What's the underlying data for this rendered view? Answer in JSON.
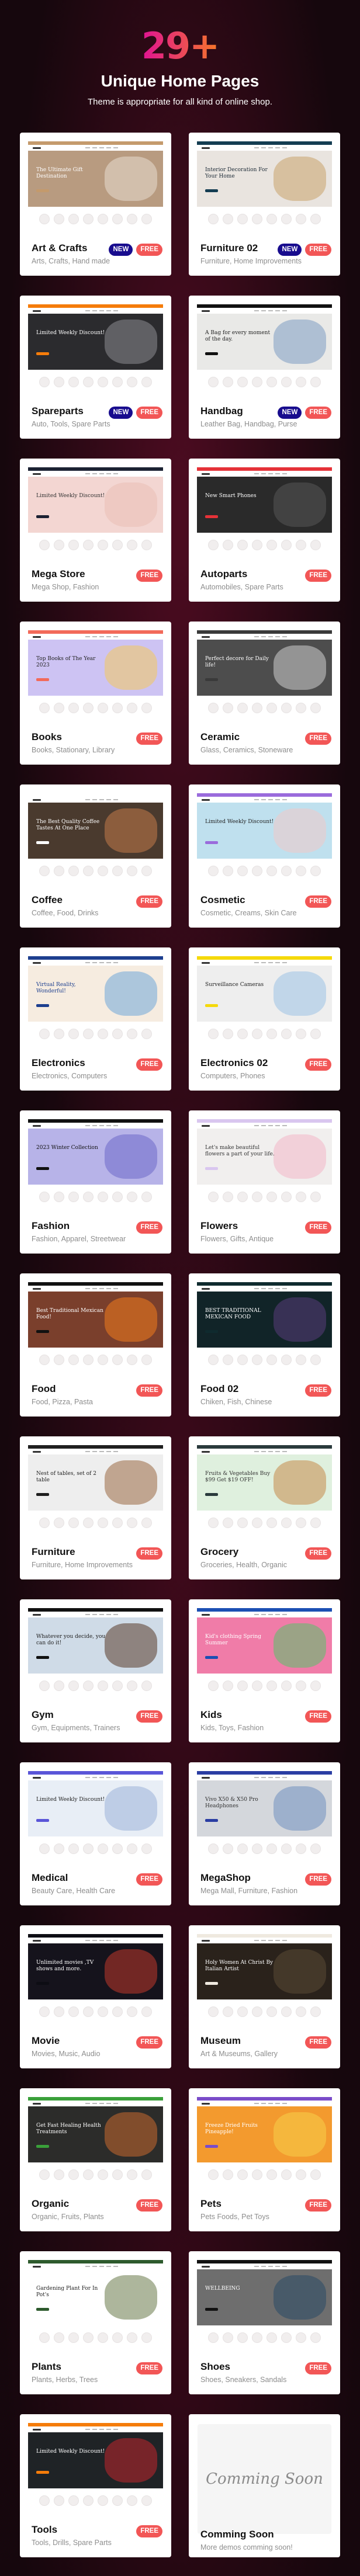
{
  "header": {
    "count": "29+",
    "title": "Unique Home Pages",
    "subtitle": "Theme is appropriate for all kind of online shop."
  },
  "colors": {
    "new_badge": "#180c8e",
    "free_badge": "#f25656",
    "count_gradient": [
      "#e0168f",
      "#f5732c"
    ]
  },
  "cards": [
    {
      "title": "Art & Crafts",
      "subtitle": "Arts, Crafts, Hand made",
      "badges": [
        "NEW",
        "FREE"
      ],
      "preview": {
        "bar": "#c49a6c",
        "hero": "#b89b80",
        "deco": "#e8dccf",
        "text": "The Ultimate Gift Destination",
        "text_color": "#fff"
      }
    },
    {
      "title": "Furniture 02",
      "subtitle": "Furniture, Home Improvements",
      "badges": [
        "NEW",
        "FREE"
      ],
      "preview": {
        "bar": "#143d52",
        "hero": "#e9e4df",
        "deco": "#c9a26a",
        "text": "Interior Decoration For Your Home",
        "text_color": "#1c2a36"
      }
    },
    {
      "title": "Spareparts",
      "subtitle": "Auto, Tools, Spare Parts",
      "badges": [
        "NEW",
        "FREE"
      ],
      "preview": {
        "bar": "#f57c0a",
        "hero": "#2b2b2e",
        "deco": "#8d8d92",
        "text": "Limited Weekly Discount!",
        "text_color": "#fff"
      }
    },
    {
      "title": "Handbag",
      "subtitle": "Leather Bag, Handbag, Purse",
      "badges": [
        "NEW",
        "FREE"
      ],
      "preview": {
        "bar": "#111111",
        "hero": "#e9e9e7",
        "deco": "#7e9cc2",
        "text": "A Bag for every moment of the day.",
        "text_color": "#222"
      }
    },
    {
      "title": "Mega Store",
      "subtitle": "Mega Shop, Fashion",
      "badges": [
        "FREE"
      ],
      "preview": {
        "bar": "#1c2233",
        "hero": "#f3d6d2",
        "deco": "#e9c0b4",
        "text": "Limited Weekly Discount!",
        "text_color": "#333"
      }
    },
    {
      "title": "Autoparts",
      "subtitle": "Automobiles, Spare Parts",
      "badges": [
        "FREE"
      ],
      "preview": {
        "bar": "#e53238",
        "hero": "#2a2a2a",
        "deco": "#555",
        "text": "New Smart Phones",
        "text_color": "#fff"
      }
    },
    {
      "title": "Books",
      "subtitle": "Books, Stationary, Library",
      "badges": [
        "FREE"
      ],
      "preview": {
        "bar": "#f26a5a",
        "hero": "#cdc3f3",
        "deco": "#f4c95d",
        "text": "Top Books of The Year 2023",
        "text_color": "#222"
      }
    },
    {
      "title": "Ceramic",
      "subtitle": "Glass, Ceramics, Stoneware",
      "badges": [
        "FREE"
      ],
      "preview": {
        "bar": "#3a3a3a",
        "hero": "#4d4d4d",
        "deco": "#cfcfcf",
        "text": "Perfect decore for Daily life!",
        "text_color": "#fff"
      }
    },
    {
      "title": "Coffee",
      "subtitle": "Coffee, Food, Drinks",
      "badges": [
        "FREE"
      ],
      "preview": {
        "bar": "#ffffff",
        "hero": "#4a3a2e",
        "deco": "#c27a4a",
        "text": "The Best Quality Coffee Tastes At One Place",
        "text_color": "#fff"
      }
    },
    {
      "title": "Cosmetic",
      "subtitle": "Cosmetic, Creams, Skin Care",
      "badges": [
        "FREE"
      ],
      "preview": {
        "bar": "#9a6bdc",
        "hero": "#bfe0ee",
        "deco": "#f1c8c8",
        "text": "Limited Weekly Discount!",
        "text_color": "#222"
      }
    },
    {
      "title": "Electronics",
      "subtitle": "Electronics, Computers",
      "badges": [
        "FREE"
      ],
      "preview": {
        "bar": "#1d3f8f",
        "hero": "#f6ece0",
        "deco": "#6fa7d8",
        "text": "Virtual Reality, Wonderful!",
        "text_color": "#1d3f8f"
      }
    },
    {
      "title": "Electronics 02",
      "subtitle": "Computers, Phones",
      "badges": [
        "FREE"
      ],
      "preview": {
        "bar": "#f5d90a",
        "hero": "#eeeeee",
        "deco": "#9cc3e6",
        "text": "Surveillance Cameras",
        "text_color": "#222"
      }
    },
    {
      "title": "Fashion",
      "subtitle": "Fashion, Apparel, Streetwear",
      "badges": [
        "FREE"
      ],
      "preview": {
        "bar": "#111111",
        "hero": "#b7b3e8",
        "deco": "#6d67c9",
        "text": "2023 Winter Collection",
        "text_color": "#111"
      }
    },
    {
      "title": "Flowers",
      "subtitle": "Flowers, Gifts, Antique",
      "badges": [
        "FREE"
      ],
      "preview": {
        "bar": "#d9c6ef",
        "hero": "#f1efee",
        "deco": "#f2b6c9",
        "text": "Let's make beautiful flowers a part of your life.",
        "text_color": "#333"
      }
    },
    {
      "title": "Food",
      "subtitle": "Food, Pizza, Pasta",
      "badges": [
        "FREE"
      ],
      "preview": {
        "bar": "#111111",
        "hero": "#7a3f2c",
        "deco": "#f07b1e",
        "text": "Best Traditional Mexican Food!",
        "text_color": "#fff"
      }
    },
    {
      "title": "Food 02",
      "subtitle": "Chiken, Fish, Chinese",
      "badges": [
        "FREE"
      ],
      "preview": {
        "bar": "#0f2a2e",
        "hero": "#112428",
        "deco": "#5a3c7a",
        "text": "BEST TRADITIONAL MEXICAN FOOD",
        "text_color": "#fff"
      }
    },
    {
      "title": "Furniture",
      "subtitle": "Furniture, Home Improvements",
      "badges": [
        "FREE"
      ],
      "preview": {
        "bar": "#1f1f1f",
        "hero": "#eeeeee",
        "deco": "#9a6a44",
        "text": "Nest of tables, set of 2 table",
        "text_color": "#222"
      }
    },
    {
      "title": "Grocery",
      "subtitle": "Groceries, Health, Organic",
      "badges": [
        "FREE"
      ],
      "preview": {
        "bar": "#2a3a3c",
        "hero": "#dff0de",
        "deco": "#c48a4a",
        "text": "Fruits & Vegetables Buy $99 Get $19 OFF!",
        "text_color": "#333"
      }
    },
    {
      "title": "Gym",
      "subtitle": "Gym, Equipments, Trainers",
      "badges": [
        "FREE"
      ],
      "preview": {
        "bar": "#111111",
        "hero": "#cfdbe7",
        "deco": "#5a3a2a",
        "text": "Whatever you decide, you can do it!",
        "text_color": "#222"
      }
    },
    {
      "title": "Kids",
      "subtitle": "Kids, Toys, Fashion",
      "badges": [
        "FREE"
      ],
      "preview": {
        "bar": "#1b4fb3",
        "hero": "#f07ca8",
        "deco": "#56c26a",
        "text": "Kid's clothing Spring Summer",
        "text_color": "#fff"
      }
    },
    {
      "title": "Medical",
      "subtitle": "Beauty Care, Health Care",
      "badges": [
        "FREE"
      ],
      "preview": {
        "bar": "#5a55d8",
        "hero": "#e8eef6",
        "deco": "#9ab3d8",
        "text": "Limited Weekly Discount!",
        "text_color": "#222"
      }
    },
    {
      "title": "MegaShop",
      "subtitle": "Mega Mall, Furniture, Fashion",
      "badges": [
        "FREE"
      ],
      "preview": {
        "bar": "#2a3da3",
        "hero": "#d4d7dc",
        "deco": "#7090c0",
        "text": "Vivo X50 & X50 Pro Headphones",
        "text_color": "#333"
      }
    },
    {
      "title": "Movie",
      "subtitle": "Movies, Music, Audio",
      "badges": [
        "FREE"
      ],
      "preview": {
        "bar": "#0d0d14",
        "hero": "#15131c",
        "deco": "#c0392b",
        "text": "Unlimited movies ,TV shows and more.",
        "text_color": "#fff"
      }
    },
    {
      "title": "Museum",
      "subtitle": "Art & Museums, Gallery",
      "badges": [
        "FREE"
      ],
      "preview": {
        "bar": "#efe9df",
        "hero": "#2a221b",
        "deco": "#5a4a35",
        "text": "Holy Women At Christ By Italian Artist",
        "text_color": "#fff"
      }
    },
    {
      "title": "Organic",
      "subtitle": "Organic, Fruits, Plants",
      "badges": [
        "FREE"
      ],
      "preview": {
        "bar": "#3aa03a",
        "hero": "#2c2c2a",
        "deco": "#c8692e",
        "text": "Get Fast Healing Health Treatments",
        "text_color": "#fff"
      }
    },
    {
      "title": "Pets",
      "subtitle": "Pets Foods, Pet Toys",
      "badges": [
        "FREE"
      ],
      "preview": {
        "bar": "#7a4cc9",
        "hero": "#f39a2e",
        "deco": "#f5d04a",
        "text": "Freeze Dried Fruits Pineapple!",
        "text_color": "#fff"
      }
    },
    {
      "title": "Plants",
      "subtitle": "Plants, Herbs, Trees",
      "badges": [
        "FREE"
      ],
      "preview": {
        "bar": "#2d5a2d",
        "hero": "#ffffff",
        "deco": "#6a7a4a",
        "text": "Gardening Plant For In Pot's",
        "text_color": "#222"
      }
    },
    {
      "title": "Shoes",
      "subtitle": "Shoes, Sneakers, Sandals",
      "badges": [
        "FREE"
      ],
      "preview": {
        "bar": "#111111",
        "hero": "#6e6e6e",
        "deco": "#2a4a66",
        "text": "WELLBEING",
        "text_color": "#fff"
      }
    },
    {
      "title": "Tools",
      "subtitle": "Tools, Drills, Spare Parts",
      "badges": [
        "FREE"
      ],
      "preview": {
        "bar": "#f57c0a",
        "hero": "#1f2326",
        "deco": "#c0262b",
        "text": "Limited Weekly Discount!",
        "text_color": "#fff"
      }
    },
    {
      "title": "Comming Soon",
      "subtitle": "More demos comming soon!",
      "badges": [],
      "coming_soon": "Comming Soon"
    }
  ]
}
